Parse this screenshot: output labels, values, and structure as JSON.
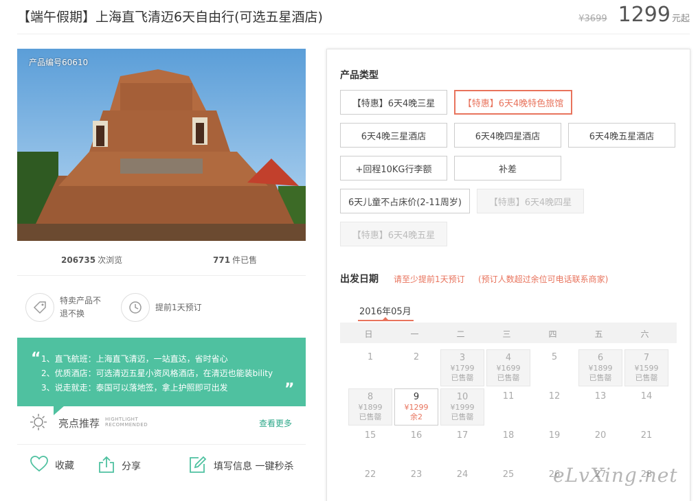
{
  "header": {
    "title": "【端午假期】上海直飞清迈6天自由行(可选五星酒店)",
    "old_price": "¥3699",
    "price": "1299",
    "price_unit": "元起"
  },
  "left": {
    "product_code": "产品编号60610",
    "views_count": "206735",
    "views_label": "次浏览",
    "sold_count": "771",
    "sold_label": "件已售",
    "feature_1": "特卖产品不退不换",
    "feature_2": "提前1天预订",
    "highlights": [
      "1、直飞航班：上海直飞清迈，一站直达，省时省心",
      "2、优质酒店：可选清迈五星小资风格酒店，在清迈也能装bility",
      "3、说走就走：泰国可以落地签，拿上护照即可出发"
    ],
    "quote_open": "“",
    "quote_close": "”",
    "recommend_title": "亮点推荐",
    "recommend_en_1": "HIGHTLIGHT",
    "recommend_en_2": "RECOMMENDED",
    "see_more": "查看更多",
    "favorite": "收藏",
    "share": "分享",
    "fill_info": "填写信息 一键秒杀"
  },
  "right": {
    "product_type_title": "产品类型",
    "options": [
      {
        "label": "【特惠】6天4晚三星",
        "state": "normal"
      },
      {
        "label": "【特惠】6天4晚特色旅馆",
        "state": "selected"
      },
      {
        "label": "6天4晚三星酒店",
        "state": "normal"
      },
      {
        "label": "6天4晚四星酒店",
        "state": "normal"
      },
      {
        "label": "6天4晚五星酒店",
        "state": "normal"
      },
      {
        "label": "+回程10KG行李额",
        "state": "normal"
      },
      {
        "label": "补差",
        "state": "normal"
      },
      {
        "label": "6天儿童不占床价(2-11周岁)",
        "state": "normal"
      },
      {
        "label": "【特惠】6天4晚四星",
        "state": "disabled"
      },
      {
        "label": "【特惠】6天4晚五星",
        "state": "disabled"
      }
    ],
    "departure_title": "出发日期",
    "note_1": "请至少提前1天预订",
    "note_2": "(预订人数超过余位可电话联系商家)",
    "month": "2016年05月",
    "weekdays": [
      "日",
      "一",
      "二",
      "三",
      "四",
      "五",
      "六"
    ],
    "days": {
      "d1": {
        "day": "1"
      },
      "d2": {
        "day": "2"
      },
      "d3": {
        "day": "3",
        "price": "¥1799",
        "status": "已售罄"
      },
      "d4": {
        "day": "4",
        "price": "¥1699",
        "status": "已售罄"
      },
      "d5": {
        "day": "5"
      },
      "d6": {
        "day": "6",
        "price": "¥1899",
        "status": "已售罄"
      },
      "d7": {
        "day": "7",
        "price": "¥1599",
        "status": "已售罄"
      },
      "d8": {
        "day": "8",
        "price": "¥1899",
        "status": "已售罄"
      },
      "d9": {
        "day": "9",
        "price": "¥1299",
        "status": "余2"
      },
      "d10": {
        "day": "10",
        "price": "¥1999",
        "status": "已售罄"
      },
      "d11": {
        "day": "11"
      },
      "d12": {
        "day": "12"
      },
      "d13": {
        "day": "13"
      },
      "d14": {
        "day": "14"
      },
      "d15": {
        "day": "15"
      },
      "d16": {
        "day": "16"
      },
      "d17": {
        "day": "17"
      },
      "d18": {
        "day": "18"
      },
      "d19": {
        "day": "19"
      },
      "d20": {
        "day": "20"
      },
      "d21": {
        "day": "21"
      },
      "d22": {
        "day": "22"
      },
      "d23": {
        "day": "23"
      },
      "d24": {
        "day": "24"
      },
      "d25": {
        "day": "25"
      },
      "d26": {
        "day": "26"
      },
      "d27": {
        "day": "27"
      },
      "d28": {
        "day": "28"
      }
    }
  },
  "watermark": "eLvXing.net",
  "colors": {
    "accent": "#e8735c",
    "green": "#4fc1a0",
    "link_green": "#2fa88a"
  }
}
